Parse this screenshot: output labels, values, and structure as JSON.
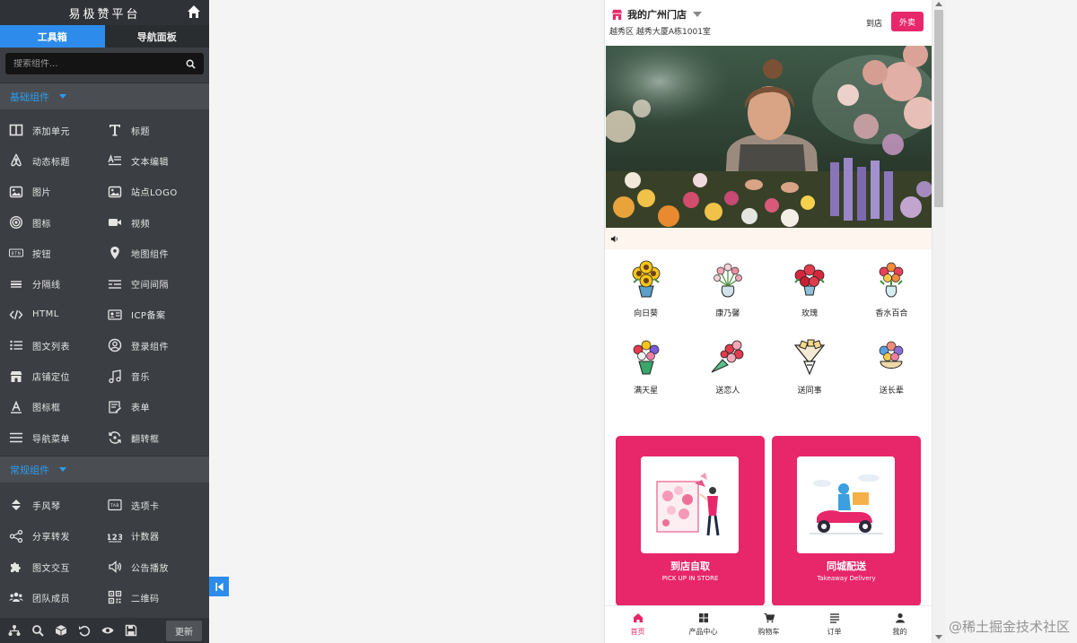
{
  "panel": {
    "title": "易极赞平台",
    "tabs": [
      {
        "label": "工具箱",
        "active": true
      },
      {
        "label": "导航面板",
        "active": false
      }
    ],
    "search_placeholder": "搜索组件...",
    "sections": [
      {
        "title": "基础组件",
        "items": [
          {
            "label": "添加单元",
            "icon": "columns-icon"
          },
          {
            "label": "标题",
            "icon": "title-t-icon"
          },
          {
            "label": "动态标题",
            "icon": "airbnb-icon"
          },
          {
            "label": "文本编辑",
            "icon": "text-edit-icon"
          },
          {
            "label": "图片",
            "icon": "image-icon"
          },
          {
            "label": "站点LOGO",
            "icon": "logo-image-icon"
          },
          {
            "label": "图标",
            "icon": "target-icon"
          },
          {
            "label": "视频",
            "icon": "video-icon"
          },
          {
            "label": "按钮",
            "icon": "btn-icon"
          },
          {
            "label": "地图组件",
            "icon": "map-pin-icon"
          },
          {
            "label": "分隔线",
            "icon": "divider-icon"
          },
          {
            "label": "空间间隔",
            "icon": "spacer-icon"
          },
          {
            "label": "HTML",
            "icon": "code-icon"
          },
          {
            "label": "ICP备案",
            "icon": "id-card-icon"
          },
          {
            "label": "图文列表",
            "icon": "list-icon"
          },
          {
            "label": "登录组件",
            "icon": "user-circle-icon"
          },
          {
            "label": "店铺定位",
            "icon": "store-icon"
          },
          {
            "label": "音乐",
            "icon": "music-icon"
          },
          {
            "label": "图标框",
            "icon": "icon-box-icon"
          },
          {
            "label": "表单",
            "icon": "form-icon"
          },
          {
            "label": "导航菜单",
            "icon": "menu-icon"
          },
          {
            "label": "翻转框",
            "icon": "flip-icon"
          }
        ]
      },
      {
        "title": "常规组件",
        "items": [
          {
            "label": "手风琴",
            "icon": "accordion-icon"
          },
          {
            "label": "选项卡",
            "icon": "tab-icon"
          },
          {
            "label": "分享转发",
            "icon": "share-icon"
          },
          {
            "label": "计数器",
            "icon": "counter-icon"
          },
          {
            "label": "图文交互",
            "icon": "puzzle-icon"
          },
          {
            "label": "公告播放",
            "icon": "speaker-icon"
          },
          {
            "label": "团队成员",
            "icon": "team-icon"
          },
          {
            "label": "二维码",
            "icon": "qrcode-icon"
          }
        ]
      }
    ],
    "bottom_icons": [
      "sitemap-icon",
      "search-icon",
      "cube-icon",
      "undo-icon",
      "eye-icon",
      "save-icon"
    ],
    "update_label": "更新"
  },
  "phone": {
    "store_name": "我的广州门店",
    "store_address": "越秀区 越秀大厦A栋1001室",
    "dine_in_label": "到店",
    "takeout_label": "外卖",
    "categories": [
      {
        "label": "向日葵"
      },
      {
        "label": "康乃馨"
      },
      {
        "label": "玫瑰"
      },
      {
        "label": "香水百合"
      },
      {
        "label": "满天星"
      },
      {
        "label": "送恋人"
      },
      {
        "label": "送同事"
      },
      {
        "label": "送长辈"
      }
    ],
    "cards": [
      {
        "title": "到店自取",
        "subtitle": "PICK UP IN STORE"
      },
      {
        "title": "同城配送",
        "subtitle": "Takeaway Delivery"
      }
    ],
    "tabbar": [
      {
        "label": "首页",
        "active": true,
        "icon": "home-icon"
      },
      {
        "label": "产品中心",
        "active": false,
        "icon": "grid-icon"
      },
      {
        "label": "购物车",
        "active": false,
        "icon": "cart-icon"
      },
      {
        "label": "订单",
        "active": false,
        "icon": "order-icon"
      },
      {
        "label": "我的",
        "active": false,
        "icon": "user-icon"
      }
    ],
    "accent_color": "#e8266a"
  },
  "watermark": "@稀土掘金技术社区"
}
